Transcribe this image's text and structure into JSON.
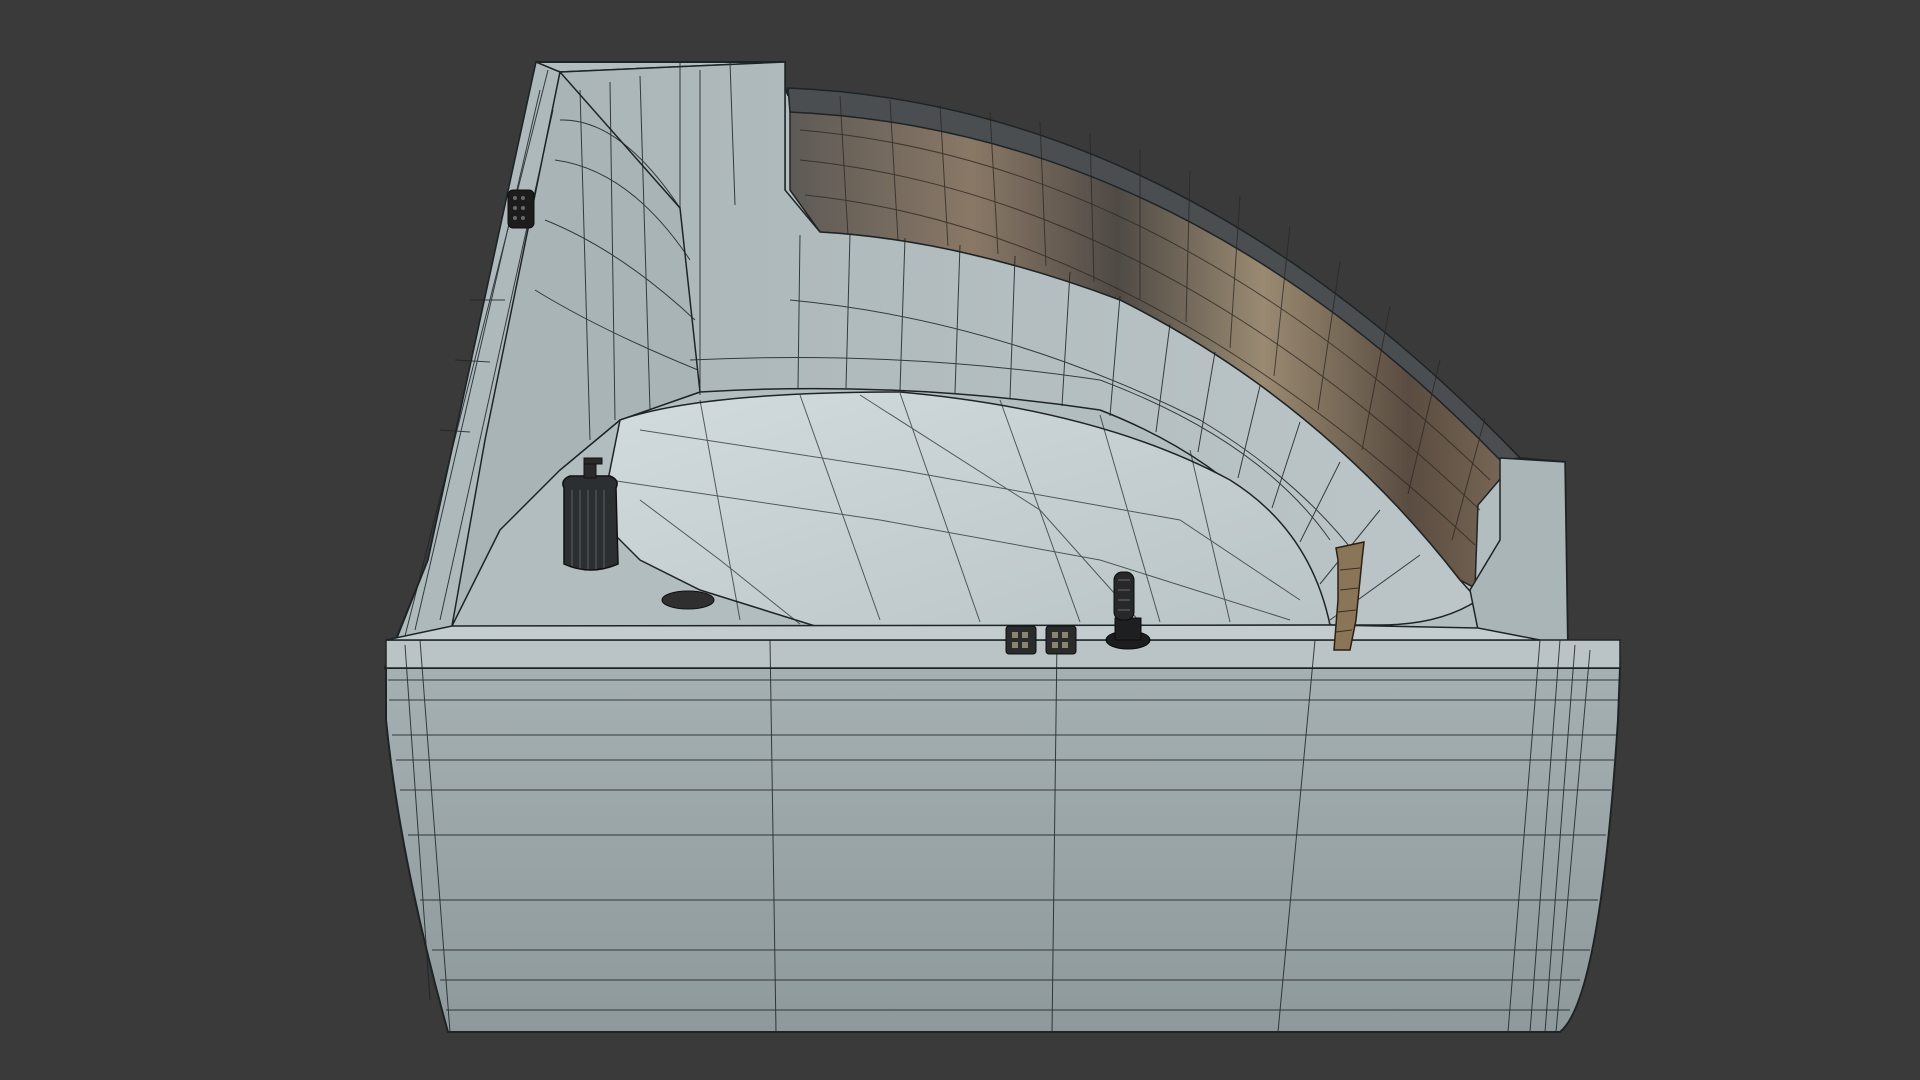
{
  "viewport": {
    "background_color": "#3a3a3a",
    "shading": "solid-with-wireframe-overlay"
  },
  "model": {
    "object": "corner bathtub",
    "body_color": "#96a1a4",
    "rim_color": "#b4bfc2",
    "basin_floor_color": "#c7d1d3",
    "wireframe_color": "#1e2426",
    "mirror_panel_color": "#6b5d52",
    "accessories": [
      "soap-dispenser-icon",
      "faucet-icon",
      "spout-icon",
      "valve-knob-icon",
      "valve-knob-icon",
      "speaker-grille-icon"
    ]
  }
}
